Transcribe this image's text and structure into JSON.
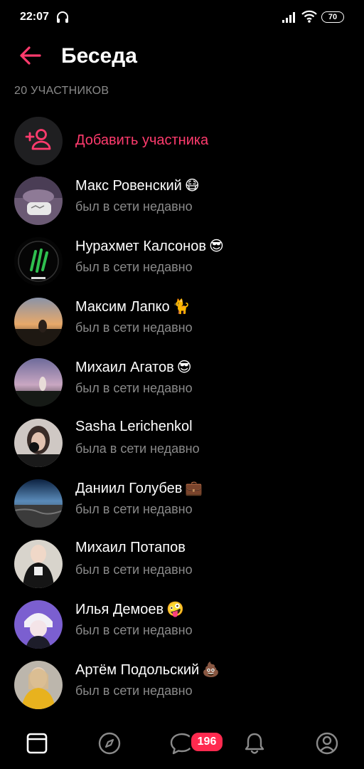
{
  "status_bar": {
    "time": "22:07",
    "battery": "70",
    "icons": [
      "headphones-icon",
      "signal-icon",
      "wifi-icon",
      "battery-icon"
    ]
  },
  "header": {
    "title": "Беседа",
    "back_icon": "arrow-left-icon"
  },
  "participants_count": "20 УЧАСТНИКОВ",
  "add_member": {
    "label": "Добавить участника",
    "icon": "add-user-icon"
  },
  "members": [
    {
      "name": "Макс Ровенский",
      "emoji": "😷",
      "status": "был в сети недавно"
    },
    {
      "name": "Нурахмет Калсонов",
      "emoji": "😎",
      "status": "был в сети недавно"
    },
    {
      "name": "Максим Лапко",
      "emoji": "🐈",
      "status": "был в сети недавно"
    },
    {
      "name": "Михаил Агатов",
      "emoji": "😎",
      "status": "был в сети недавно"
    },
    {
      "name": "Sasha Lerichenkol",
      "emoji": "",
      "status": "была в сети недавно"
    },
    {
      "name": "Даниил Голубев",
      "emoji": "💼",
      "status": "был в сети недавно"
    },
    {
      "name": "Михаил Потапов",
      "emoji": "",
      "status": "был в сети недавно"
    },
    {
      "name": "Илья Демоев",
      "emoji": "🤪",
      "status": "был в сети недавно"
    },
    {
      "name": "Артём Подольский",
      "emoji": "💩",
      "status": "был в сети недавно"
    }
  ],
  "bottom_nav": {
    "items": [
      "feed-icon",
      "discover-icon",
      "messages-icon",
      "notifications-icon",
      "profile-icon"
    ],
    "messages_badge": "196"
  },
  "colors": {
    "accent": "#ff3b6d",
    "background": "#000000",
    "secondary_text": "#8a8a8a",
    "badge": "#ff2a4f"
  }
}
